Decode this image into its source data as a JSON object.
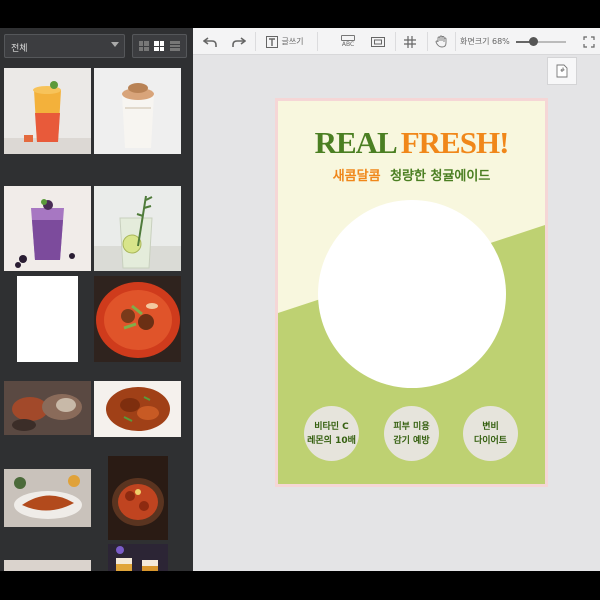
{
  "left_panel": {
    "filter": {
      "value": "전체"
    },
    "thumbnails": [
      {
        "name": "thumb-orange-smoothie",
        "bg": "#e8e6e4",
        "art": "#f0a33c"
      },
      {
        "name": "thumb-milk-dalgona",
        "bg": "#ececec",
        "art": "#c9a37a"
      },
      {
        "name": "thumb-berry-smoothie",
        "bg": "#efe9e6",
        "art": "#8f5aa0"
      },
      {
        "name": "thumb-lime-soda",
        "bg": "#e9ebe8",
        "art": "#cfd9b7"
      },
      {
        "name": "thumb-blank",
        "bg": "#ffffff",
        "art": "#ffffff"
      },
      {
        "name": "thumb-spicy-stew",
        "bg": "#3a2a22",
        "art": "#d13e1f"
      },
      {
        "name": "thumb-shellfish",
        "bg": "#5b4a43",
        "art": "#a24a2a"
      },
      {
        "name": "thumb-braised-chicken",
        "bg": "#f3eeea",
        "art": "#9a3a14"
      },
      {
        "name": "thumb-grilled-fish",
        "bg": "#c8c1ba",
        "art": "#b24b1d"
      },
      {
        "name": "thumb-sausage-platter",
        "bg": "#2c1c14",
        "art": "#c2441e"
      },
      {
        "name": "thumb-fried-dish",
        "bg": "#d9d2cc",
        "art": "#c0622a"
      },
      {
        "name": "thumb-beer-glasses",
        "bg": "#2b2433",
        "art": "#e0a53a"
      }
    ]
  },
  "toolbar": {
    "text_label": "글쓰기",
    "abc_label": "ABC",
    "zoom_label": "화면크기",
    "zoom_value": "68%",
    "zoom_fraction": 0.35,
    "side_label": "#"
  },
  "poster": {
    "title_part1": "REAL",
    "title_part2": "FRESH!",
    "subtitle_part1": "새콤달콤",
    "subtitle_part2": "청량한 청귤에이드",
    "badges": [
      {
        "line1": "비타민 C",
        "line2": "레몬의 10배"
      },
      {
        "line1": "피부 미용",
        "line2": "감기 예방"
      },
      {
        "line1": "변비",
        "line2": "다이어트"
      }
    ],
    "colors": {
      "bg_top": "#f8f7de",
      "bg_bottom": "#bed172",
      "green": "#4b7f22",
      "orange": "#f0871a"
    }
  }
}
